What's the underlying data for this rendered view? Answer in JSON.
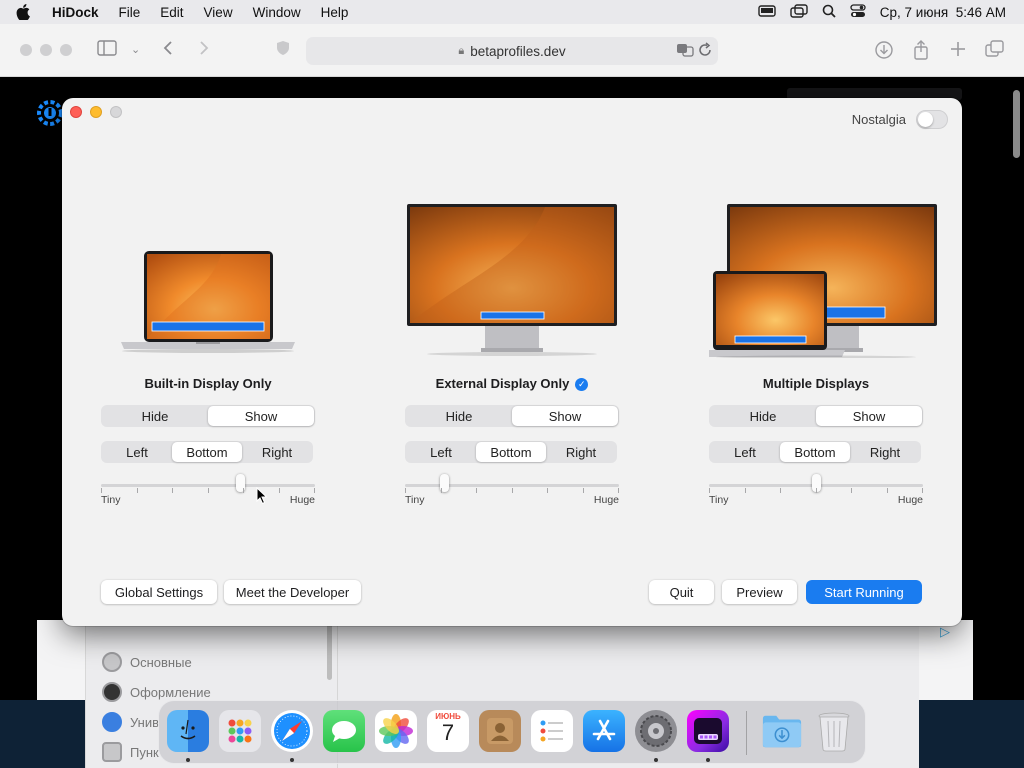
{
  "menubar": {
    "app_name": "HiDock",
    "menus": [
      "File",
      "Edit",
      "View",
      "Window",
      "Help"
    ],
    "date_time": "Ср, 7 июня  5:46 AM"
  },
  "browser": {
    "url": "betaprofiles.dev"
  },
  "background_page": {
    "sidebar_items": [
      "Основные",
      "Оформление",
      "Унив",
      "Пунк"
    ]
  },
  "hidock": {
    "nostalgia_label": "Nostalgia",
    "nostalgia_on": false,
    "columns": [
      {
        "title": "Built-in Display Only",
        "selected_mark": false,
        "visibility": [
          "Hide",
          "Show"
        ],
        "visibility_selected": "Show",
        "position": [
          "Left",
          "Bottom",
          "Right"
        ],
        "position_selected": "Bottom",
        "size_level": 0.66,
        "size_min_label": "Tiny",
        "size_max_label": "Huge"
      },
      {
        "title": "External Display Only",
        "selected_mark": true,
        "visibility": [
          "Hide",
          "Show"
        ],
        "visibility_selected": "Show",
        "position": [
          "Left",
          "Bottom",
          "Right"
        ],
        "position_selected": "Bottom",
        "size_level": 0.17,
        "size_min_label": "Tiny",
        "size_max_label": "Huge"
      },
      {
        "title": "Multiple Displays",
        "selected_mark": false,
        "visibility": [
          "Hide",
          "Show"
        ],
        "visibility_selected": "Show",
        "position": [
          "Left",
          "Bottom",
          "Right"
        ],
        "position_selected": "Bottom",
        "size_level": 0.5,
        "size_min_label": "Tiny",
        "size_max_label": "Huge"
      }
    ],
    "buttons": {
      "global_settings": "Global Settings",
      "meet_developer": "Meet the Developer",
      "quit": "Quit",
      "preview": "Preview",
      "start_running": "Start Running"
    }
  },
  "dock": {
    "apps": [
      "Finder",
      "Launchpad",
      "Safari",
      "Messages",
      "Photos",
      "Calendar",
      "Contacts",
      "Reminders",
      "App Store",
      "System Settings",
      "HiDock",
      "Downloads",
      "Trash"
    ],
    "calendar_month": "ИЮНЬ",
    "calendar_day": "7"
  },
  "colors": {
    "accent": "#1a7cf0",
    "close": "#fe5f57",
    "minimize": "#febc2e"
  }
}
